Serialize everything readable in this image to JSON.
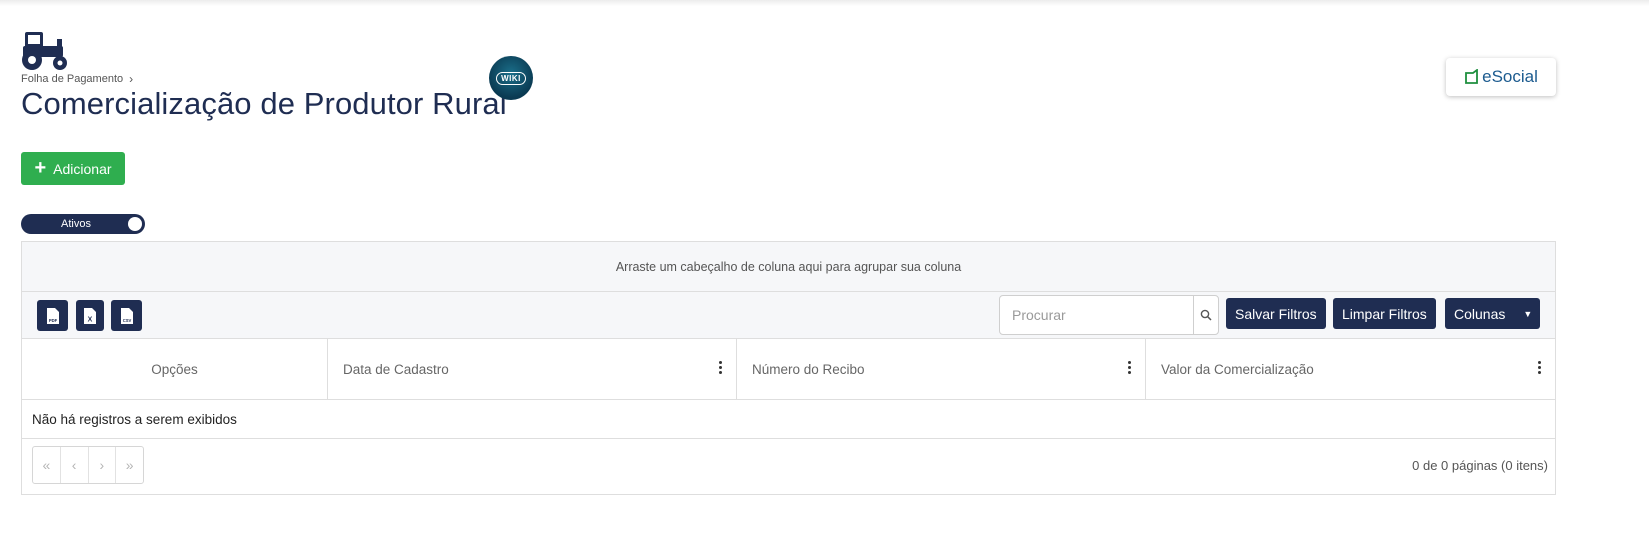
{
  "breadcrumb": {
    "parent": "Folha de Pagamento"
  },
  "page": {
    "title": "Comercialização de Produtor Rural"
  },
  "wiki": {
    "label": "WIKI"
  },
  "esocial": {
    "label": "eSocial"
  },
  "actions": {
    "add_label": "Adicionar"
  },
  "filter": {
    "active_label": "Ativos",
    "active": true
  },
  "grid": {
    "group_hint": "Arraste um cabeçalho de coluna aqui para agrupar sua coluna",
    "export_buttons": [
      {
        "icon": "pdf-icon",
        "text": "PDF"
      },
      {
        "icon": "excel-icon",
        "text": "X"
      },
      {
        "icon": "csv-icon",
        "text": "CSV"
      }
    ],
    "search_placeholder": "Procurar",
    "save_filters_label": "Salvar Filtros",
    "clear_filters_label": "Limpar Filtros",
    "columns_label": "Colunas",
    "columns": [
      "Opções",
      "Data de Cadastro",
      "Número do Recibo",
      "Valor da Comercialização"
    ],
    "empty_message": "Não há registros a serem exibidos",
    "pager": {
      "first": "«",
      "prev": "‹",
      "next": "›",
      "last": "»"
    },
    "pager_info": "0 de 0 páginas (0 itens)"
  },
  "colors": {
    "navy": "#1f2d52",
    "green": "#2fae4f",
    "esocial_blue": "#1c5b8f"
  }
}
